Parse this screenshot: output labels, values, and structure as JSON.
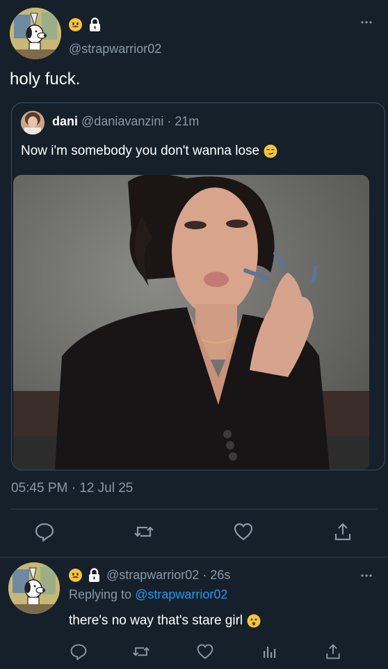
{
  "main_tweet": {
    "handle": "@strapwarrior02",
    "text": "holy fuck.",
    "timestamp": "05:45 PM · 12 Jul 25"
  },
  "quote": {
    "name": "dani",
    "meta": "@daniavanzini · 21m",
    "text": "Now i'm somebody you don't wanna lose"
  },
  "reply": {
    "meta": "@strapwarrior02 · 26s",
    "replying_prefix": "Replying to ",
    "replying_to": "@strapwarrior02",
    "text": "there's no way that's stare girl"
  },
  "icons": {
    "reply": "comment-icon",
    "retweet": "retweet-icon",
    "like": "heart-icon",
    "share": "share-icon",
    "views": "analytics-icon",
    "more": "more-icon",
    "lock": "lock-icon"
  },
  "colors": {
    "background": "#15202b",
    "secondary_text": "#8b98a5",
    "link": "#1d9bf0",
    "border": "#38444d"
  }
}
